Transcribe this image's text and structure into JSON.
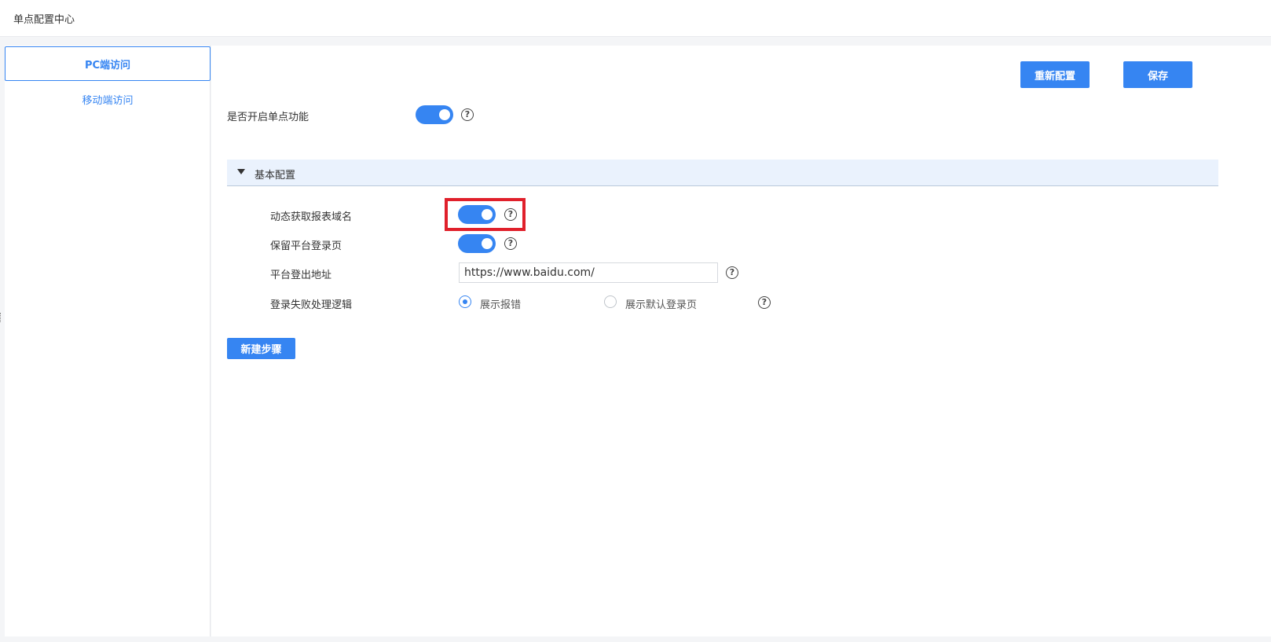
{
  "header": {
    "title": "单点配置中心"
  },
  "sidebar": {
    "items": [
      {
        "label": "PC端访问",
        "active": true
      },
      {
        "label": "移动端访问",
        "active": false
      }
    ]
  },
  "toolbar": {
    "reconfigure_label": "重新配置",
    "save_label": "保存"
  },
  "sso_toggle": {
    "label": "是否开启单点功能",
    "enabled": true
  },
  "basic_config": {
    "title": "基本配置",
    "dynamic_domain": {
      "label": "动态获取报表域名",
      "enabled": true
    },
    "keep_login_page": {
      "label": "保留平台登录页",
      "enabled": true
    },
    "logout_url": {
      "label": "平台登出地址",
      "value": "https://www.baidu.com/"
    },
    "login_fail": {
      "label": "登录失败处理逻辑",
      "options": [
        {
          "label": "展示报错",
          "checked": true
        },
        {
          "label": "展示默认登录页",
          "checked": false
        }
      ]
    }
  },
  "new_step_label": "新建步骤",
  "help_glyph": "?",
  "colors": {
    "accent": "#3685f2",
    "highlight": "#e0202b",
    "section_bg": "#eaf2fd"
  }
}
